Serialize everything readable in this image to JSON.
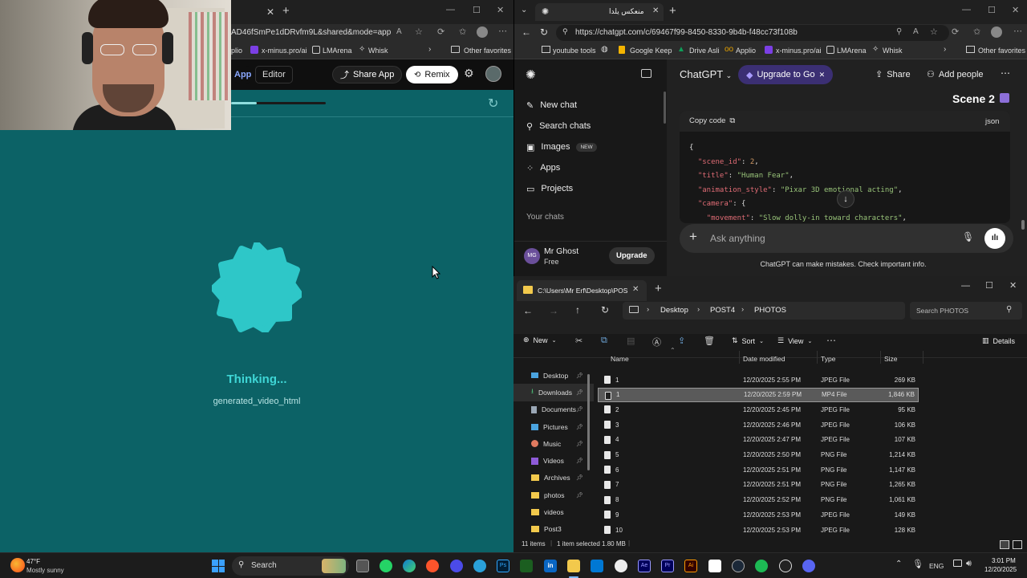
{
  "left_browser": {
    "url_fragment": "AD46fSmPe1dDRvfm9L&shared&mode=app",
    "bookmarks": [
      "plio",
      "x-minus.pro/ai",
      "LMArena",
      "Whisk"
    ],
    "other_favorites": "Other favorites",
    "app_tab": "App",
    "editor_tab": "Editor",
    "share_app": "Share App",
    "remix": "Remix",
    "status_title": "Thinking...",
    "status_sub": "generated_video_html"
  },
  "right_browser": {
    "tab_title": "منعكس يلدا",
    "url": "https://chatgpt.com/c/69467f99-8450-8330-9b4b-f48cc73f108b",
    "bookmarks": [
      "youtube tools",
      "Google Keep",
      "Drive Asli",
      "Applio",
      "x-minus.pro/ai",
      "LMArena",
      "Whisk"
    ],
    "other_favorites": "Other favorites"
  },
  "chatgpt": {
    "sidebar": {
      "items": [
        "New chat",
        "Search chats",
        "Images",
        "Apps",
        "Projects"
      ],
      "images_badge": "NEW",
      "section": "Your chats",
      "user_initials": "MG",
      "user_name": "Mr Ghost",
      "user_plan": "Free",
      "upgrade_label": "Upgrade"
    },
    "header": {
      "model": "ChatGPT",
      "upgrade_pill": "Upgrade to Go",
      "share": "Share",
      "add_people": "Add people"
    },
    "scene_heading": "Scene 2",
    "code_block": {
      "copy": "Copy code",
      "lang": "json",
      "lines": {
        "l0": "{",
        "l1k": "\"scene_id\"",
        "l1v": "2",
        "l2k": "\"title\"",
        "l2v": "\"Human Fear\"",
        "l3k": "\"animation_style\"",
        "l3v": "\"Pixar 3D emotional acting\"",
        "l4k": "\"camera\"",
        "l4v": "{",
        "l5k": "\"movement\"",
        "l5v": "\"Slow dolly-in toward characters\""
      }
    },
    "composer": {
      "placeholder": "Ask anything",
      "disclaimer": "ChatGPT can make mistakes. Check important info."
    }
  },
  "explorer": {
    "tab_title": "C:\\Users\\Mr Erf\\Desktop\\POS",
    "breadcrumb": [
      "Desktop",
      "POST4",
      "PHOTOS"
    ],
    "search_placeholder": "Search PHOTOS",
    "toolbar": {
      "new": "New",
      "sort": "Sort",
      "view": "View",
      "details": "Details"
    },
    "columns": {
      "name": "Name",
      "date": "Date modified",
      "type": "Type",
      "size": "Size"
    },
    "nav": [
      "Desktop",
      "Downloads",
      "Documents",
      "Pictures",
      "Music",
      "Videos",
      "Archives",
      "photos",
      "videos",
      "Post3"
    ],
    "files": [
      {
        "name": "1",
        "date": "12/20/2025 2:55 PM",
        "type": "JPEG File",
        "size": "269 KB"
      },
      {
        "name": "1",
        "date": "12/20/2025 2:59 PM",
        "type": "MP4 File",
        "size": "1,846 KB"
      },
      {
        "name": "2",
        "date": "12/20/2025 2:45 PM",
        "type": "JPEG File",
        "size": "95 KB"
      },
      {
        "name": "3",
        "date": "12/20/2025 2:46 PM",
        "type": "JPEG File",
        "size": "106 KB"
      },
      {
        "name": "4",
        "date": "12/20/2025 2:47 PM",
        "type": "JPEG File",
        "size": "107 KB"
      },
      {
        "name": "5",
        "date": "12/20/2025 2:50 PM",
        "type": "PNG File",
        "size": "1,214 KB"
      },
      {
        "name": "6",
        "date": "12/20/2025 2:51 PM",
        "type": "PNG File",
        "size": "1,147 KB"
      },
      {
        "name": "7",
        "date": "12/20/2025 2:51 PM",
        "type": "PNG File",
        "size": "1,265 KB"
      },
      {
        "name": "8",
        "date": "12/20/2025 2:52 PM",
        "type": "PNG File",
        "size": "1,061 KB"
      },
      {
        "name": "9",
        "date": "12/20/2025 2:53 PM",
        "type": "JPEG File",
        "size": "149 KB"
      },
      {
        "name": "10",
        "date": "12/20/2025 2:53 PM",
        "type": "JPEG File",
        "size": "128 KB"
      }
    ],
    "status": {
      "items": "11 items",
      "selected": "1 item selected  1.80 MB"
    }
  },
  "taskbar": {
    "weather_temp": "47°F",
    "weather_desc": "Mostly sunny",
    "search": "Search",
    "lang": "ENG",
    "time": "3:01 PM",
    "date": "12/20/2025"
  },
  "colors": {
    "teal_bg": "#0c6266",
    "blob": "#2ec7c8",
    "thinking": "#3fd6d6",
    "accent_purple": "#6b4fd6"
  }
}
